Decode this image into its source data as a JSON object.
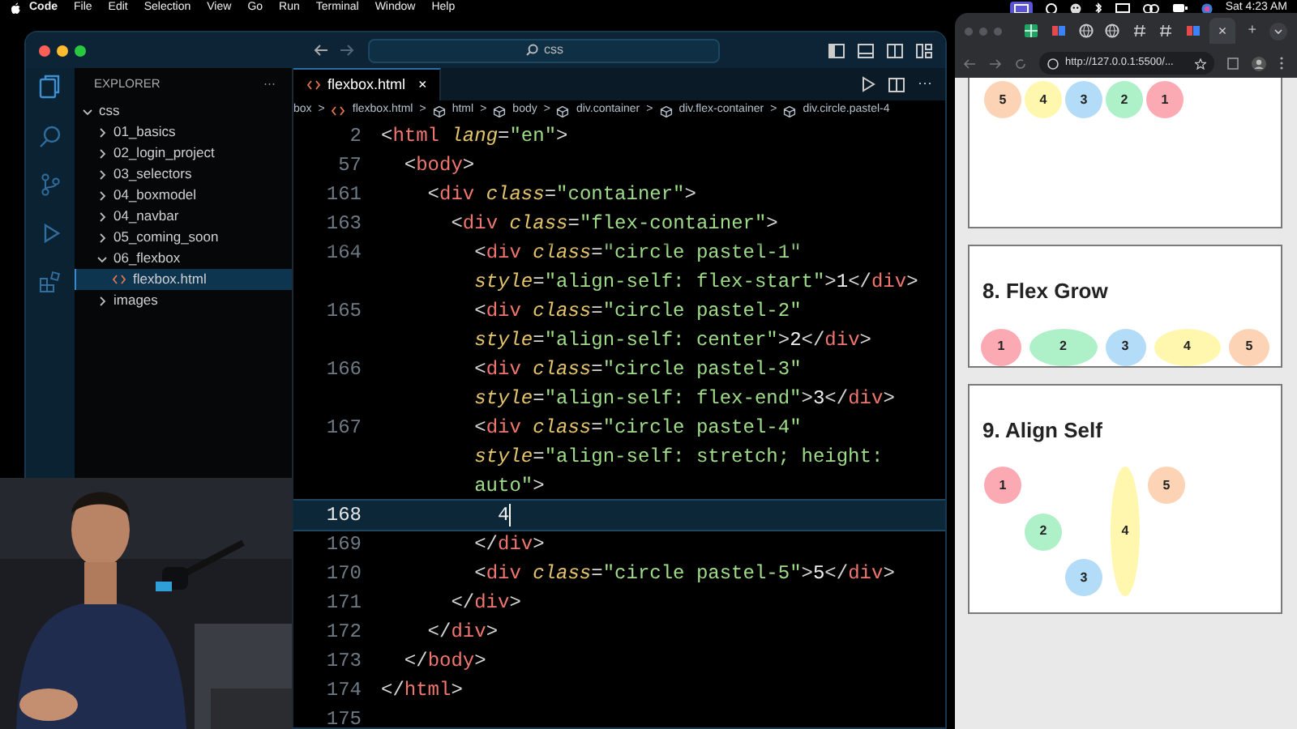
{
  "menubar": {
    "app": "Code",
    "menus": [
      "File",
      "Edit",
      "Selection",
      "View",
      "Go",
      "Run",
      "Terminal",
      "Window",
      "Help"
    ],
    "clock": "Sat 4:23 AM"
  },
  "editor_window": {
    "search": "css",
    "sidebar": {
      "title": "EXPLORER",
      "more": "···",
      "tree": [
        {
          "label": "css",
          "kind": "folder",
          "expanded": true,
          "selected": false,
          "children": [
            {
              "label": "01_basics",
              "kind": "folder",
              "expanded": false,
              "selected": false
            },
            {
              "label": "02_login_project",
              "kind": "folder",
              "expanded": false,
              "selected": false
            },
            {
              "label": "03_selectors",
              "kind": "folder",
              "expanded": false,
              "selected": false
            },
            {
              "label": "04_boxmodel",
              "kind": "folder",
              "expanded": false,
              "selected": false
            },
            {
              "label": "04_navbar",
              "kind": "folder",
              "expanded": false,
              "selected": false
            },
            {
              "label": "05_coming_soon",
              "kind": "folder",
              "expanded": false,
              "selected": false
            },
            {
              "label": "06_flexbox",
              "kind": "folder",
              "expanded": true,
              "selected": false,
              "children": [
                {
                  "label": "flexbox.html",
                  "kind": "file",
                  "selected": true
                }
              ]
            },
            {
              "label": "images",
              "kind": "folder",
              "expanded": false,
              "selected": false
            }
          ]
        }
      ]
    },
    "tab": {
      "label": "flexbox.html",
      "close": "×"
    },
    "editor_more": "···",
    "breadcrumb": {
      "separator": ">",
      "items": [
        {
          "label": "box",
          "kind": "plain"
        },
        {
          "label": "flexbox.html",
          "kind": "file"
        },
        {
          "label": "html",
          "kind": "element"
        },
        {
          "label": "body",
          "kind": "element"
        },
        {
          "label": "div.container",
          "kind": "element"
        },
        {
          "label": "div.flex-container",
          "kind": "element"
        },
        {
          "label": "div.circle.pastel-4",
          "kind": "element"
        }
      ]
    },
    "sticky_lines": [
      {
        "num": "2",
        "tokens": [
          {
            "kind": "punct",
            "text": "<"
          },
          {
            "kind": "tag",
            "text": "html"
          },
          {
            "kind": "attr",
            "text": " lang"
          },
          {
            "kind": "punct",
            "text": "="
          },
          {
            "kind": "string",
            "text": "\"en\""
          },
          {
            "kind": "punct",
            "text": ">"
          }
        ]
      },
      {
        "num": "57",
        "tokens": [
          {
            "kind": "punct",
            "text": "  <"
          },
          {
            "kind": "tag",
            "text": "body"
          },
          {
            "kind": "punct",
            "text": ">"
          }
        ]
      },
      {
        "num": "161",
        "tokens": [
          {
            "kind": "punct",
            "text": "    <"
          },
          {
            "kind": "tag",
            "text": "div"
          },
          {
            "kind": "attr",
            "text": " class"
          },
          {
            "kind": "punct",
            "text": "="
          },
          {
            "kind": "string",
            "text": "\"container\""
          },
          {
            "kind": "punct",
            "text": ">"
          }
        ]
      },
      {
        "num": "163",
        "tokens": [
          {
            "kind": "punct",
            "text": "      <"
          },
          {
            "kind": "tag",
            "text": "div"
          },
          {
            "kind": "attr",
            "text": " class"
          },
          {
            "kind": "punct",
            "text": "="
          },
          {
            "kind": "string",
            "text": "\"flex-container\""
          },
          {
            "kind": "punct",
            "text": ">"
          }
        ]
      }
    ],
    "lines": [
      {
        "num": "164",
        "current": false,
        "tokens": [
          {
            "kind": "punct",
            "text": "        <"
          },
          {
            "kind": "tag",
            "text": "div"
          },
          {
            "kind": "attr",
            "text": " class"
          },
          {
            "kind": "punct",
            "text": "="
          },
          {
            "kind": "string",
            "text": "\"circle pastel-1\""
          }
        ]
      },
      {
        "current": false,
        "tokens": [
          {
            "kind": "attr",
            "text": "        style"
          },
          {
            "kind": "punct",
            "text": "="
          },
          {
            "kind": "string",
            "text": "\"align-self: flex-start\""
          },
          {
            "kind": "punct",
            "text": ">"
          },
          {
            "kind": "text",
            "text": "1"
          },
          {
            "kind": "punct",
            "text": "</"
          },
          {
            "kind": "tag",
            "text": "div"
          },
          {
            "kind": "punct",
            "text": ">"
          }
        ]
      },
      {
        "num": "165",
        "current": false,
        "tokens": [
          {
            "kind": "punct",
            "text": "        <"
          },
          {
            "kind": "tag",
            "text": "div"
          },
          {
            "kind": "attr",
            "text": " class"
          },
          {
            "kind": "punct",
            "text": "="
          },
          {
            "kind": "string",
            "text": "\"circle pastel-2\""
          }
        ]
      },
      {
        "current": false,
        "tokens": [
          {
            "kind": "attr",
            "text": "        style"
          },
          {
            "kind": "punct",
            "text": "="
          },
          {
            "kind": "string",
            "text": "\"align-self: center\""
          },
          {
            "kind": "punct",
            "text": ">"
          },
          {
            "kind": "text",
            "text": "2"
          },
          {
            "kind": "punct",
            "text": "</"
          },
          {
            "kind": "tag",
            "text": "div"
          },
          {
            "kind": "punct",
            "text": ">"
          }
        ]
      },
      {
        "num": "166",
        "current": false,
        "tokens": [
          {
            "kind": "punct",
            "text": "        <"
          },
          {
            "kind": "tag",
            "text": "div"
          },
          {
            "kind": "attr",
            "text": " class"
          },
          {
            "kind": "punct",
            "text": "="
          },
          {
            "kind": "string",
            "text": "\"circle pastel-3\""
          }
        ]
      },
      {
        "current": false,
        "tokens": [
          {
            "kind": "attr",
            "text": "        style"
          },
          {
            "kind": "punct",
            "text": "="
          },
          {
            "kind": "string",
            "text": "\"align-self: flex-end\""
          },
          {
            "kind": "punct",
            "text": ">"
          },
          {
            "kind": "text",
            "text": "3"
          },
          {
            "kind": "punct",
            "text": "</"
          },
          {
            "kind": "tag",
            "text": "div"
          },
          {
            "kind": "punct",
            "text": ">"
          }
        ]
      },
      {
        "num": "167",
        "current": false,
        "tokens": [
          {
            "kind": "punct",
            "text": "        <"
          },
          {
            "kind": "tag",
            "text": "div"
          },
          {
            "kind": "attr",
            "text": " class"
          },
          {
            "kind": "punct",
            "text": "="
          },
          {
            "kind": "string",
            "text": "\"circle pastel-4\""
          }
        ]
      },
      {
        "current": false,
        "tokens": [
          {
            "kind": "attr",
            "text": "        style"
          },
          {
            "kind": "punct",
            "text": "="
          },
          {
            "kind": "string",
            "text": "\"align-self: stretch; height:"
          }
        ]
      },
      {
        "current": false,
        "tokens": [
          {
            "kind": "string",
            "text": "        auto\""
          },
          {
            "kind": "punct",
            "text": ">"
          }
        ]
      },
      {
        "num": "168",
        "current": true,
        "tokens": [
          {
            "kind": "text",
            "text": "          4"
          }
        ]
      },
      {
        "num": "169",
        "current": false,
        "tokens": [
          {
            "kind": "punct",
            "text": "        </"
          },
          {
            "kind": "tag",
            "text": "div"
          },
          {
            "kind": "punct",
            "text": ">"
          }
        ]
      },
      {
        "num": "170",
        "current": false,
        "tokens": [
          {
            "kind": "punct",
            "text": "        <"
          },
          {
            "kind": "tag",
            "text": "div"
          },
          {
            "kind": "attr",
            "text": " class"
          },
          {
            "kind": "punct",
            "text": "="
          },
          {
            "kind": "string",
            "text": "\"circle pastel-5\""
          },
          {
            "kind": "punct",
            "text": ">"
          },
          {
            "kind": "text",
            "text": "5"
          },
          {
            "kind": "punct",
            "text": "</"
          },
          {
            "kind": "tag",
            "text": "div"
          },
          {
            "kind": "punct",
            "text": ">"
          }
        ]
      },
      {
        "num": "171",
        "current": false,
        "tokens": [
          {
            "kind": "punct",
            "text": "      </"
          },
          {
            "kind": "tag",
            "text": "div"
          },
          {
            "kind": "punct",
            "text": ">"
          }
        ]
      },
      {
        "num": "172",
        "current": false,
        "tokens": [
          {
            "kind": "punct",
            "text": "    </"
          },
          {
            "kind": "tag",
            "text": "div"
          },
          {
            "kind": "punct",
            "text": ">"
          }
        ]
      },
      {
        "num": "173",
        "current": false,
        "tokens": [
          {
            "kind": "punct",
            "text": "  </"
          },
          {
            "kind": "tag",
            "text": "body"
          },
          {
            "kind": "punct",
            "text": ">"
          }
        ]
      },
      {
        "num": "174",
        "current": false,
        "tokens": [
          {
            "kind": "punct",
            "text": "</"
          },
          {
            "kind": "tag",
            "text": "html"
          },
          {
            "kind": "punct",
            "text": ">"
          }
        ]
      },
      {
        "num": "175",
        "current": false
      }
    ]
  },
  "browser_window": {
    "tabs": [
      {
        "kind": "sheet",
        "selected": false
      },
      {
        "kind": "app",
        "selected": false
      },
      {
        "kind": "globe",
        "selected": false
      },
      {
        "kind": "globe",
        "selected": false
      },
      {
        "kind": "hash",
        "selected": false
      },
      {
        "kind": "hash",
        "selected": false
      },
      {
        "kind": "app",
        "selected": false
      },
      {
        "kind": "blank",
        "selected": true,
        "close": "×"
      }
    ],
    "new_tab": "+",
    "address": "http://127.0.0.1:5500/...",
    "cards": [
      {
        "kind": "row",
        "circles": [
          {
            "label": "5",
            "color": "#fcd3b4"
          },
          {
            "label": "4",
            "color": "#fff7ae"
          },
          {
            "label": "3",
            "color": "#b3dcf8"
          },
          {
            "label": "2",
            "color": "#aef0c8"
          },
          {
            "label": "1",
            "color": "#fbaab4"
          }
        ]
      },
      {
        "kind": "grow",
        "title": "8. Flex Grow",
        "circles": [
          {
            "label": "1",
            "color": "#fbaab4",
            "grow": false
          },
          {
            "label": "2",
            "color": "#aef0c8",
            "grow": true
          },
          {
            "label": "3",
            "color": "#b3dcf8",
            "grow": false
          },
          {
            "label": "4",
            "color": "#fff7ae",
            "grow": true
          },
          {
            "label": "5",
            "color": "#fcd3b4",
            "grow": false
          }
        ]
      },
      {
        "kind": "align",
        "title": "9. Align Self",
        "circles": [
          {
            "label": "1",
            "color": "#fbaab4",
            "kind": "start"
          },
          {
            "label": "2",
            "color": "#aef0c8",
            "kind": "center"
          },
          {
            "label": "3",
            "color": "#b3dcf8",
            "kind": "end"
          },
          {
            "label": "4",
            "color": "#fff7ae",
            "kind": "stretch"
          },
          {
            "label": "5",
            "color": "#fcd3b4",
            "kind": "start"
          }
        ]
      }
    ]
  }
}
